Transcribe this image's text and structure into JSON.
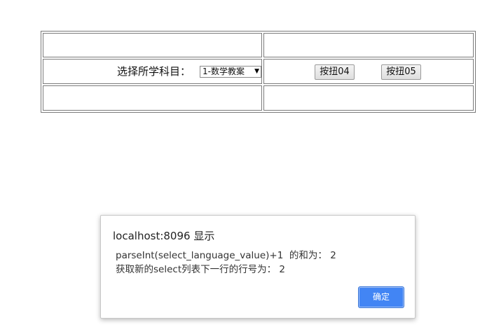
{
  "form": {
    "subject_label": "选择所学科目：",
    "subject_select_value": "1-数学教案",
    "button_04_label": "按扭04",
    "button_05_label": "按扭05"
  },
  "dialog": {
    "title": "localhost:8096 显示",
    "message_line_1": "parseInt(select_language_value)+1  的和为： 2",
    "message_line_2": "获取新的select列表下一行的行号为： 2",
    "ok_label": "确定"
  },
  "colors": {
    "ok_button": "#4285f4",
    "table_border": "#7a7a7a"
  }
}
